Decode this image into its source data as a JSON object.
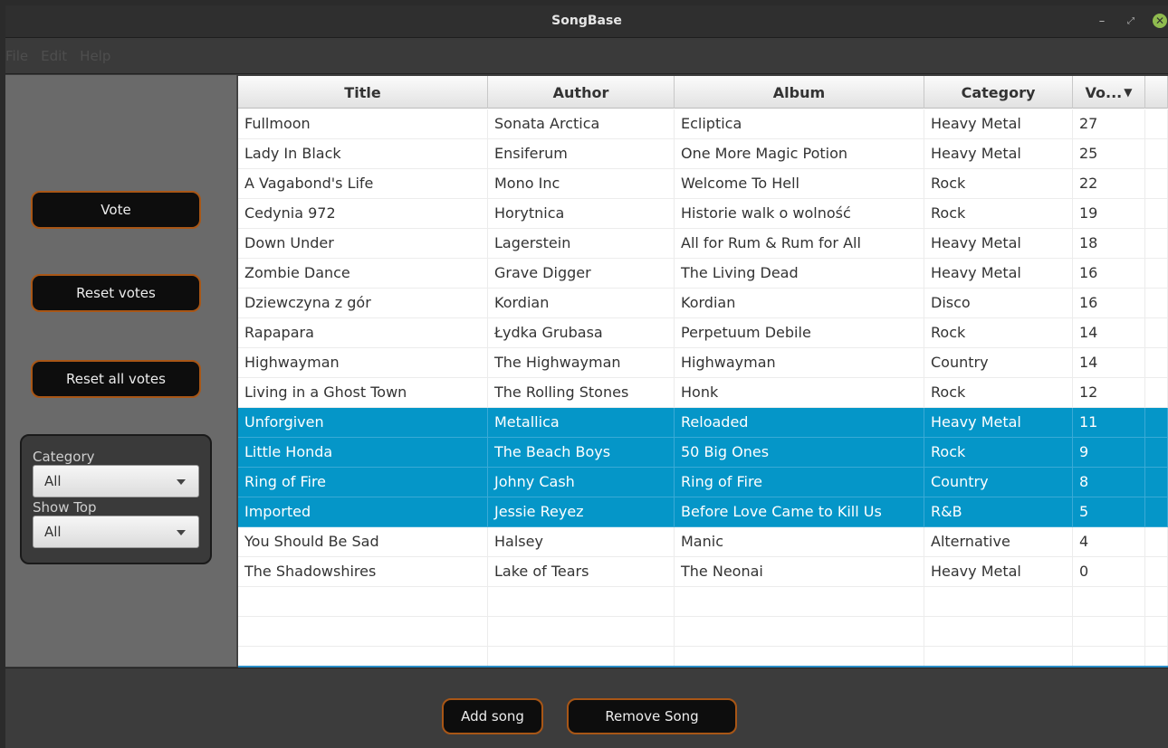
{
  "window": {
    "title": "SongBase",
    "minimize_glyph": "–",
    "maximize_glyph": "⤢",
    "close_glyph": "✕"
  },
  "menu": [
    "File",
    "Edit",
    "Help"
  ],
  "sidebar": {
    "vote_label": "Vote",
    "reset_votes_label": "Reset votes",
    "reset_all_votes_label": "Reset all votes",
    "category_label": "Category",
    "category_value": "All",
    "show_top_label": "Show Top",
    "show_top_value": "All"
  },
  "table": {
    "columns": [
      "Title",
      "Author",
      "Album",
      "Category",
      "Vo..."
    ],
    "sort_indicator": "▼",
    "rows": [
      {
        "title": "Fullmoon",
        "author": "Sonata Arctica",
        "album": "Ecliptica",
        "category": "Heavy Metal",
        "votes": "27",
        "selected": false
      },
      {
        "title": "Lady In Black",
        "author": "Ensiferum",
        "album": "One More Magic Potion",
        "category": "Heavy Metal",
        "votes": "25",
        "selected": false
      },
      {
        "title": "A Vagabond's Life",
        "author": "Mono Inc",
        "album": "Welcome To Hell",
        "category": "Rock",
        "votes": "22",
        "selected": false
      },
      {
        "title": "Cedynia 972",
        "author": "Horytnica",
        "album": "Historie walk o wolność",
        "category": "Rock",
        "votes": "19",
        "selected": false
      },
      {
        "title": "Down Under",
        "author": "Lagerstein",
        "album": "All for Rum & Rum for All",
        "category": "Heavy Metal",
        "votes": "18",
        "selected": false
      },
      {
        "title": "Zombie Dance",
        "author": "Grave Digger",
        "album": "The Living Dead",
        "category": "Heavy Metal",
        "votes": "16",
        "selected": false
      },
      {
        "title": "Dziewczyna z gór",
        "author": "Kordian",
        "album": "Kordian",
        "category": "Disco",
        "votes": "16",
        "selected": false
      },
      {
        "title": "Rapapara",
        "author": "Łydka Grubasa",
        "album": "Perpetuum Debile",
        "category": "Rock",
        "votes": "14",
        "selected": false
      },
      {
        "title": "Highwayman",
        "author": "The Highwayman",
        "album": "Highwayman",
        "category": "Country",
        "votes": "14",
        "selected": false
      },
      {
        "title": "Living in a Ghost Town",
        "author": "The Rolling Stones",
        "album": "Honk",
        "category": "Rock",
        "votes": "12",
        "selected": false
      },
      {
        "title": "Unforgiven",
        "author": "Metallica",
        "album": "Reloaded",
        "category": "Heavy Metal",
        "votes": "11",
        "selected": true
      },
      {
        "title": "Little Honda",
        "author": "The Beach Boys",
        "album": "50 Big Ones",
        "category": "Rock",
        "votes": "9",
        "selected": true
      },
      {
        "title": "Ring of Fire",
        "author": "Johny Cash",
        "album": "Ring of Fire",
        "category": "Country",
        "votes": "8",
        "selected": true
      },
      {
        "title": "Imported",
        "author": "Jessie Reyez",
        "album": "Before Love Came to Kill Us",
        "category": "R&B",
        "votes": "5",
        "selected": true
      },
      {
        "title": "You Should Be Sad",
        "author": "Halsey",
        "album": "Manic",
        "category": "Alternative",
        "votes": "4",
        "selected": false
      },
      {
        "title": "The Shadowshires",
        "author": "Lake of Tears",
        "album": "The Neonai",
        "category": "Heavy Metal",
        "votes": "0",
        "selected": false
      }
    ],
    "empty_rows": 3
  },
  "footer": {
    "add_song_label": "Add song",
    "remove_song_label": "Remove Song"
  },
  "colors": {
    "selection": "#0596c8",
    "button_border": "#a85616"
  }
}
